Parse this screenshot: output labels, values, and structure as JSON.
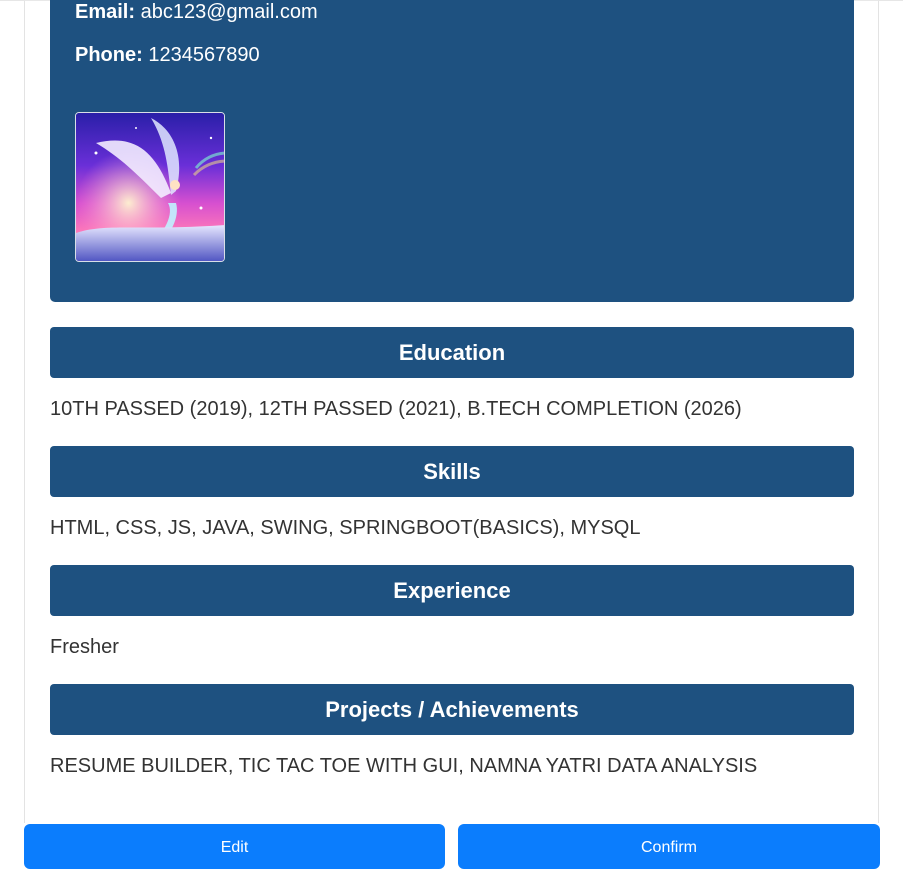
{
  "contact": {
    "email_label": "Email:",
    "email_value": "abc123@gmail.com",
    "phone_label": "Phone:",
    "phone_value": "1234567890"
  },
  "sections": {
    "education": {
      "title": "Education",
      "content": "10TH PASSED (2019), 12TH PASSED (2021), B.TECH COMPLETION (2026)"
    },
    "skills": {
      "title": "Skills",
      "content": "HTML, CSS, JS, JAVA, SWING, SPRINGBOOT(BASICS), MYSQL"
    },
    "experience": {
      "title": "Experience",
      "content": "Fresher"
    },
    "projects": {
      "title": "Projects / Achievements",
      "content": "RESUME BUILDER, TIC TAC TOE WITH GUI, NAMNA YATRI DATA ANALYSIS"
    }
  },
  "actions": {
    "edit_label": "Edit",
    "confirm_label": "Confirm"
  },
  "colors": {
    "panel": "#1e5180",
    "button": "#0b7dfd"
  }
}
